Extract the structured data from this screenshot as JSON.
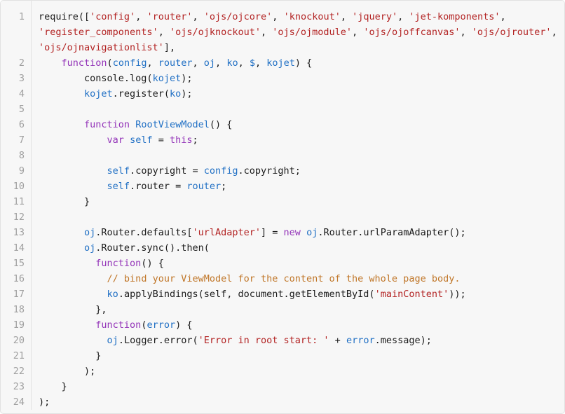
{
  "editor": {
    "language": "javascript",
    "first_line_number": 1,
    "last_line_number": 24,
    "total_lines": 24,
    "colors": {
      "background": "#f7f7f7",
      "border": "#e2e2e2",
      "gutter_text": "#a0a0a0",
      "plain_text": "#1a1a1a",
      "string": "#b32424",
      "keyword": "#9333b8",
      "identifier": "#1f6fc4",
      "comment": "#c07628"
    },
    "gutter": {
      "numbers": [
        "1",
        "2",
        "3",
        "4",
        "5",
        "6",
        "7",
        "8",
        "9",
        "10",
        "11",
        "12",
        "13",
        "14",
        "15",
        "16",
        "17",
        "18",
        "19",
        "20",
        "21",
        "22",
        "23",
        "24"
      ]
    },
    "lines": [
      {
        "number": "1",
        "wrapped": true,
        "text": "require(['config', 'router', 'ojs/ojcore', 'knockout', 'jquery', 'jet-komponents', 'register_components', 'ojs/ojknockout', 'ojs/ojmodule', 'ojs/ojoffcanvas', 'ojs/ojrouter', 'ojs/ojnavigationlist'],",
        "tokens": [
          {
            "t": "require([",
            "c": "pln"
          },
          {
            "t": "'config'",
            "c": "str"
          },
          {
            "t": ", ",
            "c": "pln"
          },
          {
            "t": "'router'",
            "c": "str"
          },
          {
            "t": ", ",
            "c": "pln"
          },
          {
            "t": "'ojs/ojcore'",
            "c": "str"
          },
          {
            "t": ", ",
            "c": "pln"
          },
          {
            "t": "'knockout'",
            "c": "str"
          },
          {
            "t": ", ",
            "c": "pln"
          },
          {
            "t": "'jquery'",
            "c": "str"
          },
          {
            "t": ", ",
            "c": "pln"
          },
          {
            "t": "'jet-komponents'",
            "c": "str"
          },
          {
            "t": ", ",
            "c": "pln"
          },
          {
            "t": "'register_components'",
            "c": "str"
          },
          {
            "t": ", ",
            "c": "pln"
          },
          {
            "t": "'ojs/ojknockout'",
            "c": "str"
          },
          {
            "t": ", ",
            "c": "pln"
          },
          {
            "t": "'ojs/ojmodule'",
            "c": "str"
          },
          {
            "t": ", ",
            "c": "pln"
          },
          {
            "t": "'ojs/ojoffcanvas'",
            "c": "str"
          },
          {
            "t": ", ",
            "c": "pln"
          },
          {
            "t": "'ojs/ojrouter'",
            "c": "str"
          },
          {
            "t": ", ",
            "c": "pln"
          },
          {
            "t": "'ojs/ojnavigationlist'",
            "c": "str"
          },
          {
            "t": "],",
            "c": "pln"
          }
        ]
      },
      {
        "number": "2",
        "text": "    function(config, router, oj, ko, $, kojet) {",
        "tokens": [
          {
            "t": "    ",
            "c": "pln"
          },
          {
            "t": "function",
            "c": "kw"
          },
          {
            "t": "(",
            "c": "pln"
          },
          {
            "t": "config",
            "c": "id"
          },
          {
            "t": ", ",
            "c": "pln"
          },
          {
            "t": "router",
            "c": "id"
          },
          {
            "t": ", ",
            "c": "pln"
          },
          {
            "t": "oj",
            "c": "id"
          },
          {
            "t": ", ",
            "c": "pln"
          },
          {
            "t": "ko",
            "c": "id"
          },
          {
            "t": ", ",
            "c": "pln"
          },
          {
            "t": "$",
            "c": "id"
          },
          {
            "t": ", ",
            "c": "pln"
          },
          {
            "t": "kojet",
            "c": "id"
          },
          {
            "t": ") {",
            "c": "pln"
          }
        ]
      },
      {
        "number": "3",
        "text": "        console.log(kojet);",
        "tokens": [
          {
            "t": "        console.log(",
            "c": "pln"
          },
          {
            "t": "kojet",
            "c": "id"
          },
          {
            "t": ");",
            "c": "pln"
          }
        ]
      },
      {
        "number": "4",
        "text": "        kojet.register(ko);",
        "tokens": [
          {
            "t": "        ",
            "c": "pln"
          },
          {
            "t": "kojet",
            "c": "id"
          },
          {
            "t": ".register(",
            "c": "pln"
          },
          {
            "t": "ko",
            "c": "id"
          },
          {
            "t": ");",
            "c": "pln"
          }
        ]
      },
      {
        "number": "5",
        "text": "",
        "tokens": []
      },
      {
        "number": "6",
        "text": "        function RootViewModel() {",
        "tokens": [
          {
            "t": "        ",
            "c": "pln"
          },
          {
            "t": "function",
            "c": "kw"
          },
          {
            "t": " ",
            "c": "pln"
          },
          {
            "t": "RootViewModel",
            "c": "id"
          },
          {
            "t": "() {",
            "c": "pln"
          }
        ]
      },
      {
        "number": "7",
        "text": "            var self = this;",
        "tokens": [
          {
            "t": "            ",
            "c": "pln"
          },
          {
            "t": "var",
            "c": "kw"
          },
          {
            "t": " ",
            "c": "pln"
          },
          {
            "t": "self",
            "c": "id"
          },
          {
            "t": " = ",
            "c": "pln"
          },
          {
            "t": "this",
            "c": "kw"
          },
          {
            "t": ";",
            "c": "pln"
          }
        ]
      },
      {
        "number": "8",
        "text": "",
        "tokens": []
      },
      {
        "number": "9",
        "text": "            self.copyright = config.copyright;",
        "tokens": [
          {
            "t": "            ",
            "c": "pln"
          },
          {
            "t": "self",
            "c": "id"
          },
          {
            "t": ".copyright = ",
            "c": "pln"
          },
          {
            "t": "config",
            "c": "id"
          },
          {
            "t": ".copyright;",
            "c": "pln"
          }
        ]
      },
      {
        "number": "10",
        "text": "            self.router = router;",
        "tokens": [
          {
            "t": "            ",
            "c": "pln"
          },
          {
            "t": "self",
            "c": "id"
          },
          {
            "t": ".router = ",
            "c": "pln"
          },
          {
            "t": "router",
            "c": "id"
          },
          {
            "t": ";",
            "c": "pln"
          }
        ]
      },
      {
        "number": "11",
        "text": "        }",
        "tokens": [
          {
            "t": "        }",
            "c": "pln"
          }
        ]
      },
      {
        "number": "12",
        "text": "",
        "tokens": []
      },
      {
        "number": "13",
        "text": "        oj.Router.defaults['urlAdapter'] = new oj.Router.urlParamAdapter();",
        "tokens": [
          {
            "t": "        ",
            "c": "pln"
          },
          {
            "t": "oj",
            "c": "id"
          },
          {
            "t": ".Router.defaults[",
            "c": "pln"
          },
          {
            "t": "'urlAdapter'",
            "c": "str"
          },
          {
            "t": "] = ",
            "c": "pln"
          },
          {
            "t": "new",
            "c": "kw"
          },
          {
            "t": " ",
            "c": "pln"
          },
          {
            "t": "oj",
            "c": "id"
          },
          {
            "t": ".Router.urlParamAdapter();",
            "c": "pln"
          }
        ]
      },
      {
        "number": "14",
        "text": "        oj.Router.sync().then(",
        "tokens": [
          {
            "t": "        ",
            "c": "pln"
          },
          {
            "t": "oj",
            "c": "id"
          },
          {
            "t": ".Router.sync().then(",
            "c": "pln"
          }
        ]
      },
      {
        "number": "15",
        "text": "          function() {",
        "tokens": [
          {
            "t": "          ",
            "c": "pln"
          },
          {
            "t": "function",
            "c": "kw"
          },
          {
            "t": "() {",
            "c": "pln"
          }
        ]
      },
      {
        "number": "16",
        "text": "            // bind your ViewModel for the content of the whole page body.",
        "tokens": [
          {
            "t": "            ",
            "c": "pln"
          },
          {
            "t": "// bind your ViewModel for the content of the whole page body.",
            "c": "com"
          }
        ]
      },
      {
        "number": "17",
        "text": "            ko.applyBindings(self, document.getElementById('mainContent'));",
        "tokens": [
          {
            "t": "            ",
            "c": "pln"
          },
          {
            "t": "ko",
            "c": "id"
          },
          {
            "t": ".applyBindings(self, document.getElementById(",
            "c": "pln"
          },
          {
            "t": "'mainContent'",
            "c": "str"
          },
          {
            "t": "));",
            "c": "pln"
          }
        ]
      },
      {
        "number": "18",
        "text": "          },",
        "tokens": [
          {
            "t": "          },",
            "c": "pln"
          }
        ]
      },
      {
        "number": "19",
        "text": "          function(error) {",
        "tokens": [
          {
            "t": "          ",
            "c": "pln"
          },
          {
            "t": "function",
            "c": "kw"
          },
          {
            "t": "(",
            "c": "pln"
          },
          {
            "t": "error",
            "c": "id"
          },
          {
            "t": ") {",
            "c": "pln"
          }
        ]
      },
      {
        "number": "20",
        "text": "            oj.Logger.error('Error in root start: ' + error.message);",
        "tokens": [
          {
            "t": "            ",
            "c": "pln"
          },
          {
            "t": "oj",
            "c": "id"
          },
          {
            "t": ".Logger.error(",
            "c": "pln"
          },
          {
            "t": "'Error in root start: '",
            "c": "str"
          },
          {
            "t": " + ",
            "c": "pln"
          },
          {
            "t": "error",
            "c": "id"
          },
          {
            "t": ".message);",
            "c": "pln"
          }
        ]
      },
      {
        "number": "21",
        "text": "          }",
        "tokens": [
          {
            "t": "          }",
            "c": "pln"
          }
        ]
      },
      {
        "number": "22",
        "text": "        );",
        "tokens": [
          {
            "t": "        );",
            "c": "pln"
          }
        ]
      },
      {
        "number": "23",
        "text": "    }",
        "tokens": [
          {
            "t": "    }",
            "c": "pln"
          }
        ]
      },
      {
        "number": "24",
        "text": ");",
        "tokens": [
          {
            "t": ");",
            "c": "pln"
          }
        ]
      }
    ]
  }
}
